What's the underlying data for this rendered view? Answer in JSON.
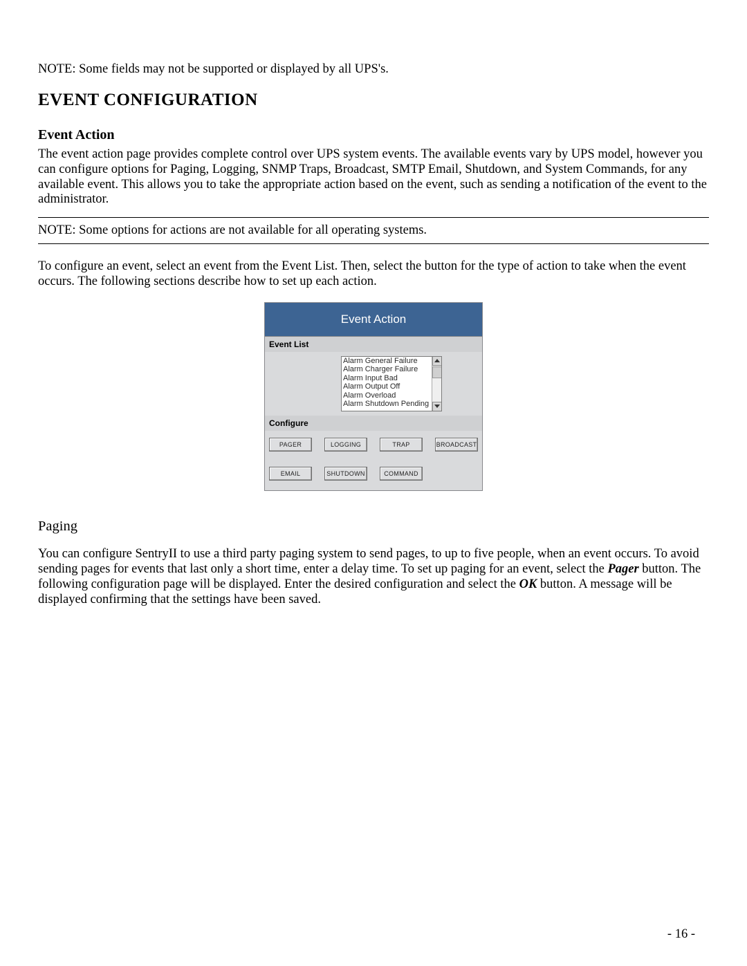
{
  "note_top": "NOTE: Some fields may not be supported or displayed by all UPS's.",
  "heading": "EVENT CONFIGURATION",
  "event_action": {
    "subheading": "Event Action",
    "paragraph": "The event action page provides complete control over UPS system events.  The available events vary by UPS model, however you can configure options for Paging, Logging, SNMP Traps, Broadcast, SMTP Email, Shutdown, and System Commands, for any available event.  This allows you to take the appropriate action based on the event, such as sending a notification of the event to the administrator."
  },
  "rule_note": "NOTE: Some options for actions are not available for all operating systems.",
  "config_intro": "To configure an event, select an event from the Event List. Then, select the button for the type of action to take when the event occurs. The following sections describe how to set up each action.",
  "panel": {
    "title": "Event Action",
    "event_list_label": "Event List",
    "configure_label": "Configure",
    "events": [
      "Alarm General Failure",
      "Alarm Charger Failure",
      "Alarm Input Bad",
      "Alarm Output Off",
      "Alarm Overload",
      "Alarm Shutdown Pending"
    ],
    "buttons_row1": [
      "PAGER",
      "LOGGING",
      "TRAP",
      "BROADCAST"
    ],
    "buttons_row2": [
      "EMAIL",
      "SHUTDOWN",
      "COMMAND"
    ]
  },
  "paging": {
    "heading": "Paging",
    "text_before_pager": "You can configure SentryII to use a third party paging system to send pages, to up to five people, when an event occurs. To avoid sending pages for events that last only a short time, enter a delay time. To set up paging for an event, select the ",
    "pager_word": "Pager",
    "text_middle": " button.  The following configuration page will be displayed.  Enter the desired configuration and select the ",
    "ok_word": "OK",
    "text_after": " button.  A message will be displayed confirming that the settings have been saved."
  },
  "page_number": "- 16 -"
}
